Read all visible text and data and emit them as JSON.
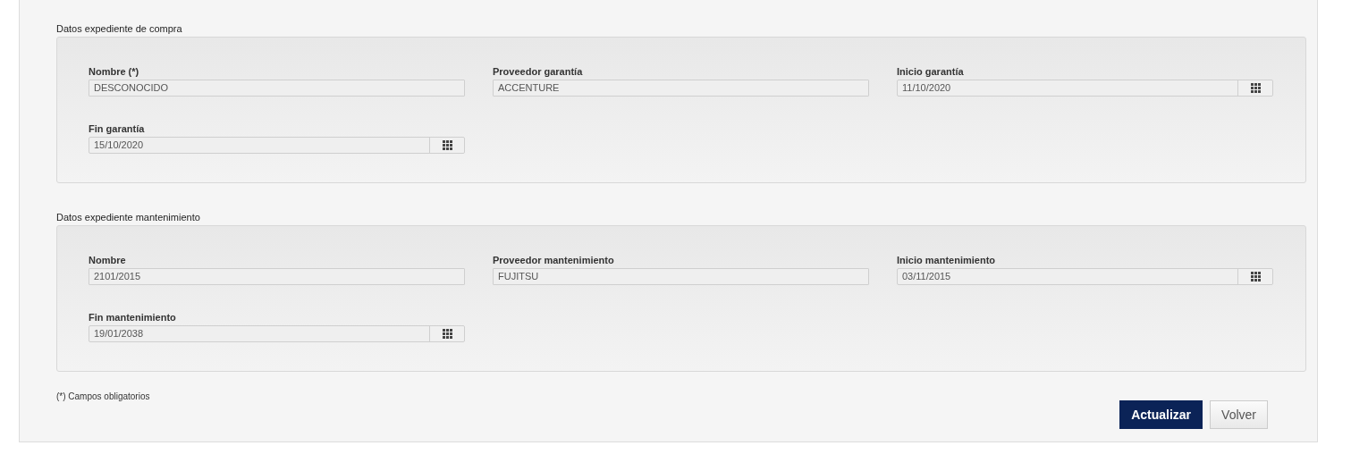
{
  "sections": [
    {
      "title": "Datos expediente de compra",
      "fields": [
        {
          "label": "Nombre (*)",
          "value": "DESCONOCIDO",
          "kind": "text"
        },
        {
          "label": "Proveedor garantía",
          "value": "ACCENTURE",
          "kind": "text"
        },
        {
          "label": "Inicio garantía",
          "value": "11/10/2020",
          "kind": "date"
        },
        {
          "label": "Fin garantía",
          "value": "15/10/2020",
          "kind": "date"
        }
      ]
    },
    {
      "title": "Datos expediente mantenimiento",
      "fields": [
        {
          "label": "Nombre",
          "value": "2101/2015",
          "kind": "text"
        },
        {
          "label": "Proveedor mantenimiento",
          "value": "FUJITSU",
          "kind": "text"
        },
        {
          "label": "Inicio mantenimiento",
          "value": "03/11/2015",
          "kind": "date"
        },
        {
          "label": "Fin mantenimiento",
          "value": "19/01/2038",
          "kind": "date"
        }
      ]
    }
  ],
  "footnote": "(*) Campos obligatorios",
  "buttons": [
    {
      "label": "Actualizar",
      "kind": "primary"
    },
    {
      "label": "Volver",
      "kind": "secondary"
    }
  ]
}
